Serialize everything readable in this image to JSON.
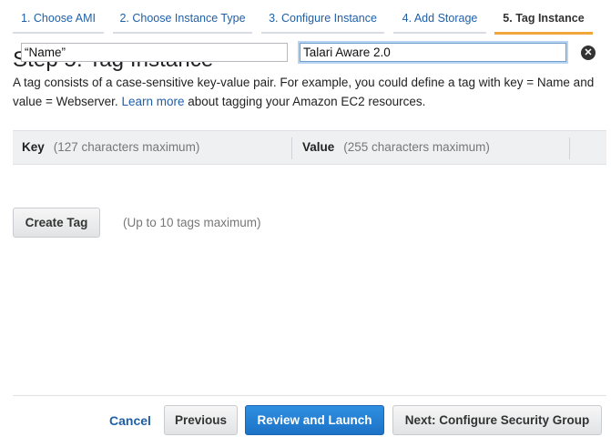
{
  "wizard": {
    "steps": [
      {
        "label": "1. Choose AMI"
      },
      {
        "label": "2. Choose Instance Type"
      },
      {
        "label": "3. Configure Instance"
      },
      {
        "label": "4. Add Storage"
      },
      {
        "label": "5. Tag Instance"
      }
    ],
    "active_step": 4
  },
  "page": {
    "title": "Step 5: Tag Instance",
    "description_part1": "A tag consists of a case-sensitive key-value pair. For example, you could define a tag with key = Name and value = Webserver.",
    "learn_more": "Learn more",
    "description_part2": "about tagging your Amazon EC2 resources."
  },
  "table": {
    "key_header": "Key",
    "key_hint": "(127 characters maximum)",
    "value_header": "Value",
    "value_hint": "(255 characters maximum)",
    "rows": [
      {
        "key": "“Name”",
        "value": "Talari Aware 2.0"
      }
    ],
    "remove_icon": "close-circle-icon"
  },
  "actions": {
    "create_tag": "Create Tag",
    "limit_text": "(Up to 10 tags maximum)",
    "cancel": "Cancel",
    "previous": "Previous",
    "review_launch": "Review and Launch",
    "next": "Next: Configure Security Group"
  },
  "colors": {
    "accent": "#f0a63a",
    "link": "#1f5fa8",
    "primary_button": "#1c72c7"
  }
}
